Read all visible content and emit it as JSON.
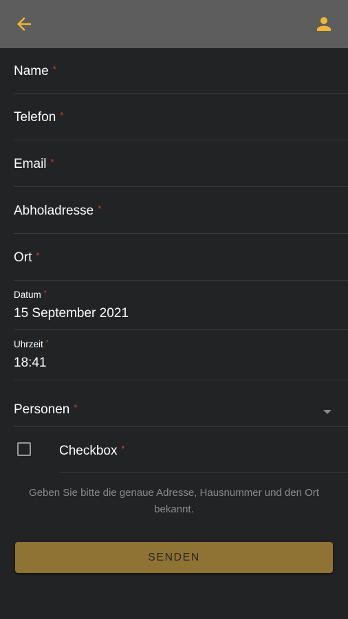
{
  "header": {
    "back_icon": "arrow-left-icon",
    "profile_icon": "person-icon",
    "accent_color": "#f2b632",
    "bar_color": "#5d5d5d"
  },
  "form": {
    "required_marker": "*",
    "fields": [
      {
        "label": "Name"
      },
      {
        "label": "Telefon"
      },
      {
        "label": "Email"
      },
      {
        "label": "Abholadresse"
      },
      {
        "label": "Ort"
      }
    ],
    "date": {
      "label": "Datum",
      "value": "15 September 2021"
    },
    "time": {
      "label": "Uhrzeit",
      "value": "18:41"
    },
    "persons": {
      "label": "Personen",
      "icon": "dropdown-caret-icon"
    },
    "checkbox": {
      "label": "Checkbox",
      "checked": false
    },
    "hint": "Geben Sie bitte die genaue Adresse, Hausnummer und den Ort bekannt.",
    "submit_label": "SENDEN",
    "submit_color": "#8f7334"
  }
}
